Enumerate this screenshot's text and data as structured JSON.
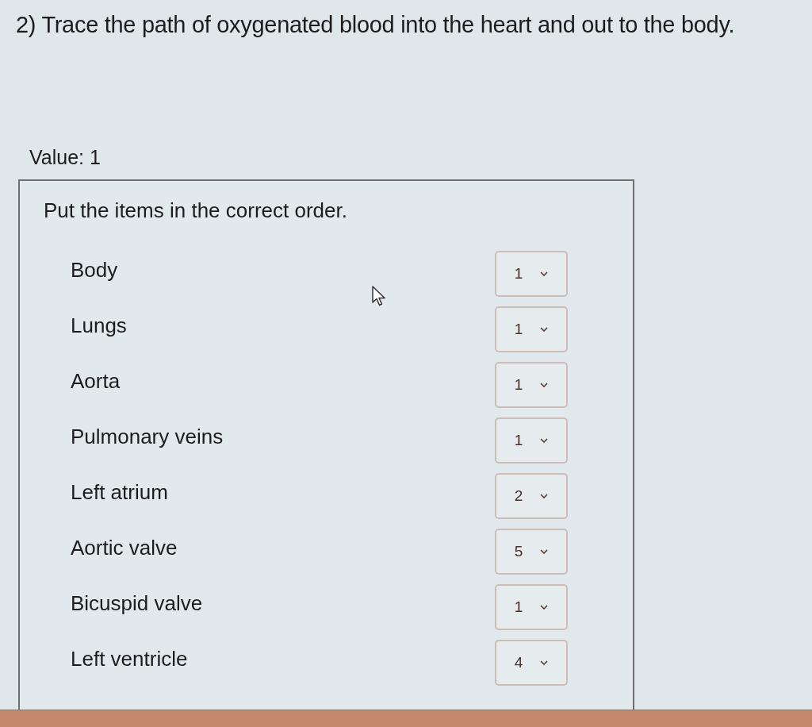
{
  "question": {
    "text": "2) Trace the path of oxygenated blood into the heart and out to the body."
  },
  "value_label": "Value: 1",
  "panel": {
    "instruction": "Put the items in the correct order.",
    "items": [
      {
        "label": "Body",
        "order_value": "1"
      },
      {
        "label": "Lungs",
        "order_value": "1"
      },
      {
        "label": "Aorta",
        "order_value": "1"
      },
      {
        "label": "Pulmonary veins",
        "order_value": "1"
      },
      {
        "label": "Left atrium",
        "order_value": "2"
      },
      {
        "label": "Aortic valve",
        "order_value": "5"
      },
      {
        "label": "Bicuspid valve",
        "order_value": "1"
      },
      {
        "label": "Left ventricle",
        "order_value": "4"
      }
    ]
  }
}
